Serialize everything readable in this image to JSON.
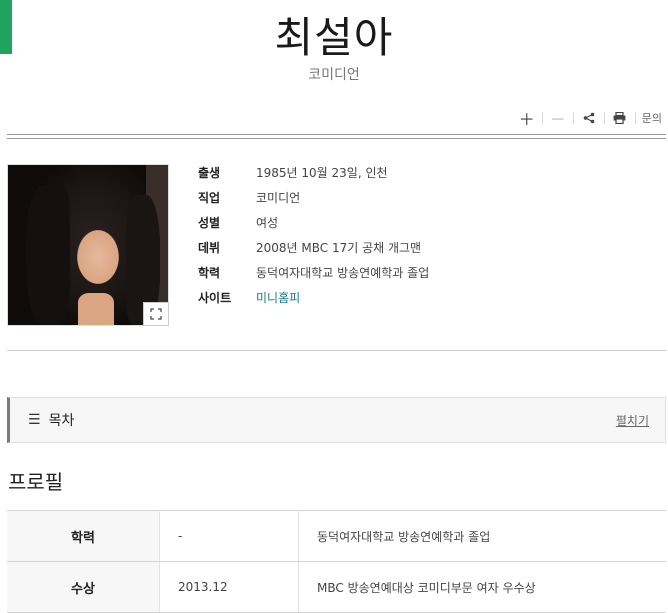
{
  "header": {
    "title": "최설아",
    "subtitle": "코미디언"
  },
  "toolbar": {
    "zoom_in_icon": "plus-icon",
    "zoom_out_icon": "minus-icon",
    "share_icon": "share-icon",
    "print_icon": "print-icon",
    "inquiry_label": "문의"
  },
  "info": {
    "rows": [
      {
        "label": "출생",
        "value": "1985년 10월 23일, 인천"
      },
      {
        "label": "직업",
        "value": "코미디언"
      },
      {
        "label": "성별",
        "value": "여성"
      },
      {
        "label": "데뷔",
        "value": "2008년 MBC 17기 공채 개그맨"
      },
      {
        "label": "학력",
        "value": "동덕여자대학교 방송연예학과 졸업"
      },
      {
        "label": "사이트",
        "value": "미니홈피"
      }
    ]
  },
  "toc": {
    "title": "목차",
    "toggle_label": "펼치기"
  },
  "profile": {
    "section_title": "프로필",
    "rows": [
      {
        "label": "학력",
        "date": "-",
        "desc": "동덕여자대학교 방송연예학과 졸업"
      },
      {
        "label": "수상",
        "date": "2013.12",
        "desc": "MBC 방송연예대상 코미디부문 여자 우수상"
      }
    ]
  },
  "colors": {
    "accent": "#1fa35f",
    "link": "#1a7a86"
  }
}
